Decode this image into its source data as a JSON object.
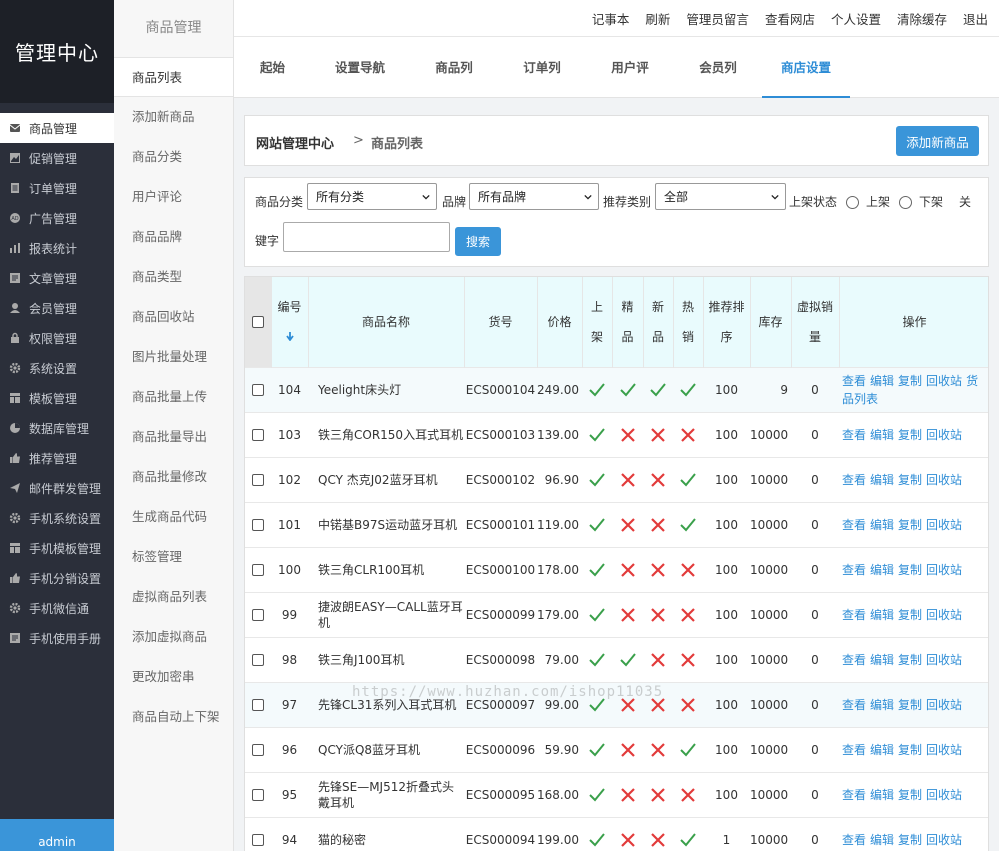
{
  "brand": {
    "title": "管理中心"
  },
  "sidebar": {
    "items": [
      {
        "label": "商品管理",
        "icon": "envelope-icon",
        "active": true
      },
      {
        "label": "促销管理",
        "icon": "image-icon"
      },
      {
        "label": "订单管理",
        "icon": "list-icon"
      },
      {
        "label": "广告管理",
        "icon": "ad-icon"
      },
      {
        "label": "报表统计",
        "icon": "bar-chart-icon"
      },
      {
        "label": "文章管理",
        "icon": "article-icon"
      },
      {
        "label": "会员管理",
        "icon": "user-icon"
      },
      {
        "label": "权限管理",
        "icon": "lock-icon"
      },
      {
        "label": "系统设置",
        "icon": "gear-icon"
      },
      {
        "label": "模板管理",
        "icon": "template-icon"
      },
      {
        "label": "数据库管理",
        "icon": "pie-chart-icon"
      },
      {
        "label": "推荐管理",
        "icon": "thumbs-up-icon"
      },
      {
        "label": "邮件群发管理",
        "icon": "send-icon"
      },
      {
        "label": "手机系统设置",
        "icon": "gear-icon"
      },
      {
        "label": "手机模板管理",
        "icon": "template-icon"
      },
      {
        "label": "手机分销设置",
        "icon": "thumbs-up-icon"
      },
      {
        "label": "手机微信通",
        "icon": "gear-icon"
      },
      {
        "label": "手机使用手册",
        "icon": "article-icon"
      }
    ],
    "user": "admin"
  },
  "submenu": {
    "title": "商品管理",
    "items": [
      "商品列表",
      "添加新商品",
      "商品分类",
      "用户评论",
      "商品品牌",
      "商品类型",
      "商品回收站",
      "图片批量处理",
      "商品批量上传",
      "商品批量导出",
      "商品批量修改",
      "生成商品代码",
      "标签管理",
      "虚拟商品列表",
      "添加虚拟商品",
      "更改加密串",
      "商品自动上下架"
    ]
  },
  "topbar": {
    "links": [
      "记事本",
      "刷新",
      "管理员留言",
      "查看网店",
      "个人设置",
      "清除缓存",
      "退出"
    ]
  },
  "tabs": [
    "起始页",
    "设置导航栏",
    "商品列表",
    "订单列表",
    "用户评论",
    "会员列表",
    "商店设置"
  ],
  "breadcrumb": {
    "home": "网站管理中心",
    "sep": ">",
    "current": "商品列表"
  },
  "add_button": "添加新商品",
  "filter": {
    "category_label": "商品分类",
    "category_value": "所有分类",
    "brand_label": "品牌",
    "brand_value": "所有品牌",
    "recommend_label": "推荐类别",
    "recommend_value": "全部",
    "status_label": "上架状态",
    "on_label": "上架",
    "off_label": "下架",
    "extra_label": "关",
    "keyword_label": "键字",
    "keyword_value": "",
    "search_button": "搜索"
  },
  "table": {
    "headers": {
      "id": [
        "编号"
      ],
      "name": "商品名称",
      "sn": "货号",
      "price": "价格",
      "on_sale": [
        "上",
        "架"
      ],
      "best": [
        "精",
        "品"
      ],
      "new": [
        "新",
        "品"
      ],
      "hot": [
        "热",
        "销"
      ],
      "sort": [
        "推荐排",
        "序"
      ],
      "stock": "库存",
      "virtual": [
        "虚拟销",
        "量"
      ],
      "ops": "操作"
    },
    "ops_labels": [
      "查看",
      "编辑",
      "复制",
      "回收站"
    ],
    "first_row_extra_op": "货品列表",
    "rows": [
      {
        "id": "104",
        "name": "Yeelight床头灯",
        "sn": "ECS000104",
        "price": "249.00",
        "on_sale": true,
        "best": true,
        "new": true,
        "hot": true,
        "sort": "100",
        "stock": "9",
        "virtual": "0"
      },
      {
        "id": "103",
        "name": "铁三角COR150入耳式耳机",
        "sn": "ECS000103",
        "price": "139.00",
        "on_sale": true,
        "best": false,
        "new": false,
        "hot": false,
        "sort": "100",
        "stock": "10000",
        "virtual": "0"
      },
      {
        "id": "102",
        "name": "QCY 杰克J02蓝牙耳机",
        "sn": "ECS000102",
        "price": "96.90",
        "on_sale": true,
        "best": false,
        "new": false,
        "hot": true,
        "sort": "100",
        "stock": "10000",
        "virtual": "0"
      },
      {
        "id": "101",
        "name": "中锘基B97S运动蓝牙耳机",
        "sn": "ECS000101",
        "price": "119.00",
        "on_sale": true,
        "best": false,
        "new": false,
        "hot": true,
        "sort": "100",
        "stock": "10000",
        "virtual": "0"
      },
      {
        "id": "100",
        "name": "铁三角CLR100耳机",
        "sn": "ECS000100",
        "price": "178.00",
        "on_sale": true,
        "best": false,
        "new": false,
        "hot": false,
        "sort": "100",
        "stock": "10000",
        "virtual": "0"
      },
      {
        "id": "99",
        "name": "捷波朗EASY—CALL蓝牙耳机",
        "sn": "ECS000099",
        "price": "179.00",
        "on_sale": true,
        "best": false,
        "new": false,
        "hot": false,
        "sort": "100",
        "stock": "10000",
        "virtual": "0"
      },
      {
        "id": "98",
        "name": "铁三角J100耳机",
        "sn": "ECS000098",
        "price": "79.00",
        "on_sale": true,
        "best": true,
        "new": false,
        "hot": false,
        "sort": "100",
        "stock": "10000",
        "virtual": "0"
      },
      {
        "id": "97",
        "name": "先锋CL31系列入耳式耳机",
        "sn": "ECS000097",
        "price": "99.00",
        "on_sale": true,
        "best": false,
        "new": false,
        "hot": false,
        "sort": "100",
        "stock": "10000",
        "virtual": "0"
      },
      {
        "id": "96",
        "name": "QCY派Q8蓝牙耳机",
        "sn": "ECS000096",
        "price": "59.90",
        "on_sale": true,
        "best": false,
        "new": false,
        "hot": true,
        "sort": "100",
        "stock": "10000",
        "virtual": "0"
      },
      {
        "id": "95",
        "name": "先锋SE—MJ512折叠式头戴耳机",
        "sn": "ECS000095",
        "price": "168.00",
        "on_sale": true,
        "best": false,
        "new": false,
        "hot": false,
        "sort": "100",
        "stock": "10000",
        "virtual": "0"
      },
      {
        "id": "94",
        "name": "猫的秘密",
        "sn": "ECS000094",
        "price": "199.00",
        "on_sale": true,
        "best": false,
        "new": false,
        "hot": true,
        "sort": "1",
        "stock": "10000",
        "virtual": "0"
      }
    ]
  },
  "watermark": "https://www.huzhan.com/ishop11035",
  "colors": {
    "accent": "#3a95d9",
    "check": "#3aa04b",
    "cross": "#e23a3a",
    "sidebar": "#2b2f3a"
  }
}
